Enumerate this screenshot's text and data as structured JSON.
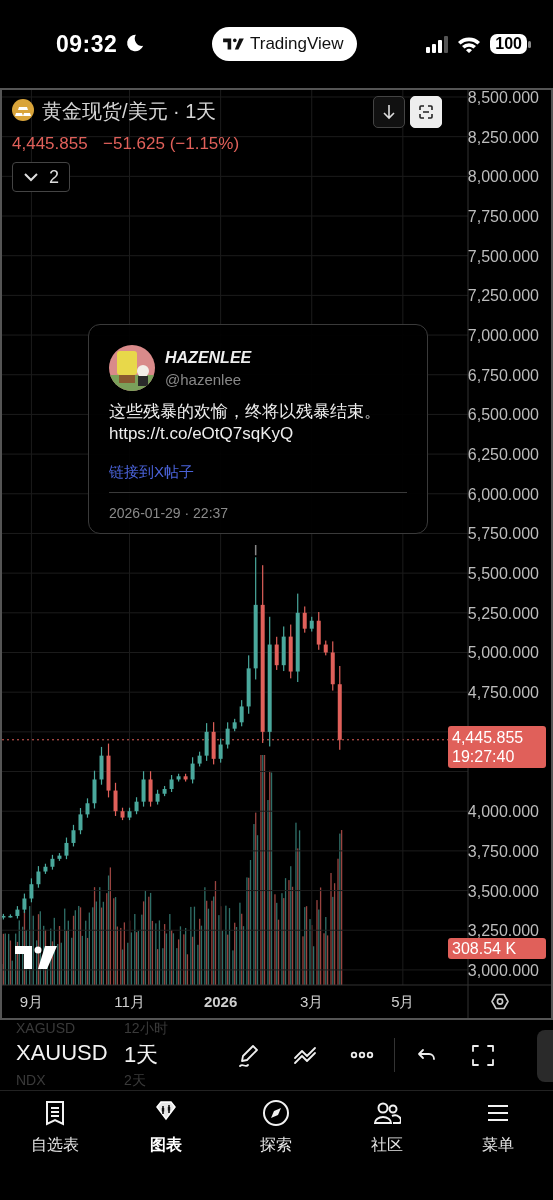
{
  "status_bar": {
    "time": "09:32",
    "app_pill": "TradingView",
    "battery": "100"
  },
  "chart": {
    "title": "黄金现货/美元 · 1天",
    "price": "4,445.855",
    "change": "−51.625 (−1.15%)",
    "indicator_count": "2",
    "last_price": "4,445.855",
    "countdown": "19:27:40",
    "volume_label": "308.54 K",
    "chart_data": {
      "type": "candlestick",
      "categories": [
        null,
        null,
        null,
        null,
        "9月",
        null,
        null,
        null,
        null,
        null,
        null,
        null,
        null,
        null,
        null,
        null,
        null,
        null,
        "11月",
        null,
        null,
        null,
        null,
        null,
        null,
        null,
        null,
        null,
        null,
        null,
        null,
        "**2026**",
        null,
        null,
        null,
        null,
        null,
        null,
        null,
        null,
        null,
        null,
        null,
        null,
        "3月",
        null,
        null,
        null,
        null,
        null,
        null,
        null,
        null,
        null,
        null,
        null,
        null,
        "5月",
        null,
        null,
        null,
        null,
        null,
        null,
        null,
        null,
        null
      ],
      "ohlc": [
        [
          3330,
          3353,
          3318,
          3340
        ],
        [
          3340,
          3350,
          3330,
          3340
        ],
        [
          3340,
          3402,
          3324,
          3380
        ],
        [
          3380,
          3481,
          3359,
          3450
        ],
        [
          3450,
          3577,
          3426,
          3540
        ],
        [
          3540,
          3654,
          3518,
          3620
        ],
        [
          3620,
          3669,
          3605,
          3650
        ],
        [
          3650,
          3725,
          3632,
          3700
        ],
        [
          3700,
          3736,
          3687,
          3720
        ],
        [
          3720,
          3834,
          3698,
          3800
        ],
        [
          3800,
          3914,
          3778,
          3880
        ],
        [
          3880,
          4020,
          3855,
          3980
        ],
        [
          3980,
          4081,
          3959,
          4050
        ],
        [
          4050,
          4255,
          4017,
          4200
        ],
        [
          4200,
          4405,
          4167,
          4350
        ],
        [
          4350,
          4426,
          4087,
          4130
        ],
        [
          4130,
          4179,
          3970,
          4000
        ],
        [
          4000,
          4022,
          3944,
          3960
        ],
        [
          3960,
          4022,
          3944,
          4000
        ],
        [
          4000,
          4088,
          3981,
          4060
        ],
        [
          4060,
          4252,
          4029,
          4200
        ],
        [
          4200,
          4252,
          4029,
          4060
        ],
        [
          4060,
          4135,
          4042,
          4110
        ],
        [
          4110,
          4159,
          4095,
          4140
        ],
        [
          4140,
          4228,
          4121,
          4200
        ],
        [
          4200,
          4236,
          4187,
          4220
        ],
        [
          4220,
          4236,
          4187,
          4200
        ],
        [
          4200,
          4340,
          4175,
          4300
        ],
        [
          4300,
          4375,
          4282,
          4350
        ],
        [
          4350,
          4555,
          4317,
          4500
        ],
        [
          4500,
          4561,
          4295,
          4330
        ],
        [
          4330,
          4457,
          4306,
          4420
        ],
        [
          4420,
          4560,
          4395,
          4520
        ],
        [
          4520,
          4582,
          4504,
          4560
        ],
        [
          4560,
          4700,
          4535,
          4660
        ],
        [
          4660,
          4982,
          4614,
          4900
        ],
        [
          4900,
          5600,
          4830,
          5300
        ],
        [
          5300,
          5550,
          4430,
          4500
        ],
        [
          4500,
          5225,
          4408,
          5050
        ],
        [
          5050,
          5099,
          4890,
          4920
        ],
        [
          4920,
          5164,
          4883,
          5100
        ],
        [
          5100,
          5176,
          4837,
          4880
        ],
        [
          4880,
          5371,
          4814,
          5250
        ],
        [
          5250,
          5290,
          5125,
          5150
        ],
        [
          5150,
          5225,
          5132,
          5200
        ],
        [
          5200,
          5255,
          5017,
          5050
        ],
        [
          5050,
          5075,
          4982,
          5000
        ],
        [
          5000,
          5070,
          4760,
          4800
        ],
        [
          4800,
          4915,
          4387,
          4450
        ],
        null,
        null,
        null,
        null,
        null,
        null,
        null,
        null,
        null,
        null,
        null,
        null,
        null,
        null,
        null,
        null,
        null,
        null
      ],
      "ylim": [
        2905,
        8544
      ],
      "grid": true,
      "yticks": [
        {
          "value": 8500,
          "label": "8,500.000"
        },
        {
          "value": 8250,
          "label": "8,250.000"
        },
        {
          "value": 8000,
          "label": "8,000.000"
        },
        {
          "value": 7750,
          "label": "7,750.000"
        },
        {
          "value": 7500,
          "label": "7,500.000"
        },
        {
          "value": 7250,
          "label": "7,250.000"
        },
        {
          "value": 7000,
          "label": "7,000.000"
        },
        {
          "value": 6750,
          "label": "6,750.000"
        },
        {
          "value": 6500,
          "label": "6,500.000"
        },
        {
          "value": 6250,
          "label": "6,250.000"
        },
        {
          "value": 6000,
          "label": "6,000.000"
        },
        {
          "value": 5750,
          "label": "5,750.000"
        },
        {
          "value": 5500,
          "label": "5,500.000"
        },
        {
          "value": 5250,
          "label": "5,250.000"
        },
        {
          "value": 5000,
          "label": "5,000.000"
        },
        {
          "value": 4750,
          "label": "4,750.000"
        },
        {
          "value": 4000,
          "label": "4,000.000"
        },
        {
          "value": 3750,
          "label": "3,750.000"
        },
        {
          "value": 3500,
          "label": "3,500.000"
        },
        {
          "value": 3250,
          "label": "3,250.000"
        },
        {
          "value": 3000,
          "label": "3,000.000"
        }
      ]
    }
  },
  "tweet": {
    "name": "HAZENLEE",
    "handle": "@hazenlee",
    "text": "这些残暴的欢愉，终将以残暴结束。",
    "url": "https://t.co/eOtQ7sqKyQ",
    "link": "链接到X帖子",
    "timestamp": "2026-01-29 · 22:37"
  },
  "symbol_picker": [
    {
      "symbol": "XAGUSD",
      "interval": "12小时",
      "selected": false
    },
    {
      "symbol": "XAUUSD",
      "interval": "1天",
      "selected": true
    },
    {
      "symbol": "NDX",
      "interval": "2天",
      "selected": false
    }
  ],
  "nav": [
    {
      "label": "自选表",
      "selected": false
    },
    {
      "label": "图表",
      "selected": true
    },
    {
      "label": "探索",
      "selected": false
    },
    {
      "label": "社区",
      "selected": false
    },
    {
      "label": "菜单",
      "selected": false
    }
  ]
}
